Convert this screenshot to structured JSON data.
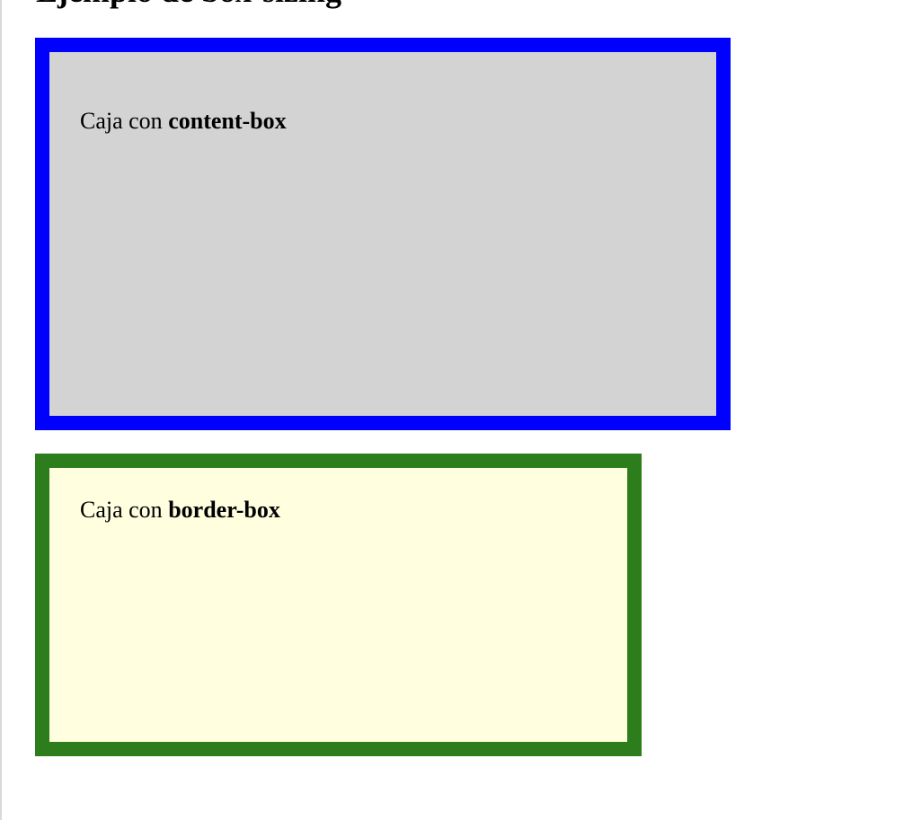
{
  "page": {
    "title": "Ejemplo de box-sizing"
  },
  "boxes": [
    {
      "prefix": "Caja con ",
      "keyword": "content-box",
      "border_color": "#0000ff",
      "background_color": "#d3d3d3"
    },
    {
      "prefix": "Caja con ",
      "keyword": "border-box",
      "border_color": "#2e7d1c",
      "background_color": "#ffffe0"
    }
  ]
}
